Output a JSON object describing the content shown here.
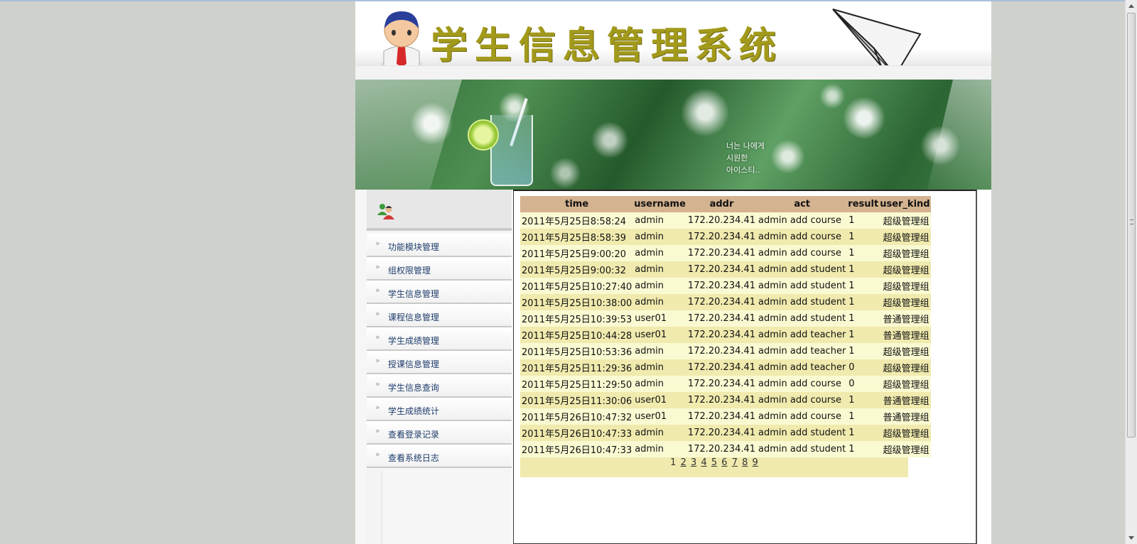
{
  "header": {
    "title": "学生信息管理系统"
  },
  "banner": {
    "overlay_text": "너는 나에게\n시원한\n아이스티.."
  },
  "sidebar": {
    "items": [
      {
        "label": "功能模块管理"
      },
      {
        "label": "组权限管理"
      },
      {
        "label": "学生信息管理"
      },
      {
        "label": "课程信息管理"
      },
      {
        "label": "学生成绩管理"
      },
      {
        "label": "授课信息管理"
      },
      {
        "label": "学生信息查询"
      },
      {
        "label": "学生成绩统计"
      },
      {
        "label": "查看登录记录"
      },
      {
        "label": "查看系统日志"
      }
    ]
  },
  "log_table": {
    "columns": [
      "time",
      "username",
      "addr",
      "act",
      "result",
      "user_kind"
    ],
    "rows": [
      [
        "2011年5月25日8:58:24",
        "admin",
        "172.20.234.41",
        "admin add course",
        "1",
        "超级管理组"
      ],
      [
        "2011年5月25日8:58:39",
        "admin",
        "172.20.234.41",
        "admin add course",
        "1",
        "超级管理组"
      ],
      [
        "2011年5月25日9:00:20",
        "admin",
        "172.20.234.41",
        "admin add course",
        "1",
        "超级管理组"
      ],
      [
        "2011年5月25日9:00:32",
        "admin",
        "172.20.234.41",
        "admin add student",
        "1",
        "超级管理组"
      ],
      [
        "2011年5月25日10:27:40",
        "admin",
        "172.20.234.41",
        "admin add student",
        "1",
        "超级管理组"
      ],
      [
        "2011年5月25日10:38:00",
        "admin",
        "172.20.234.41",
        "admin add student",
        "1",
        "超级管理组"
      ],
      [
        "2011年5月25日10:39:53",
        "user01",
        "172.20.234.41",
        "admin add student",
        "1",
        "普通管理组"
      ],
      [
        "2011年5月25日10:44:28",
        "user01",
        "172.20.234.41",
        "admin add teacher",
        "1",
        "普通管理组"
      ],
      [
        "2011年5月25日10:53:36",
        "admin",
        "172.20.234.41",
        "admin add teacher",
        "1",
        "超级管理组"
      ],
      [
        "2011年5月25日11:29:36",
        "admin",
        "172.20.234.41",
        "admin add teacher",
        "0",
        "超级管理组"
      ],
      [
        "2011年5月25日11:29:50",
        "admin",
        "172.20.234.41",
        "admin add course",
        "0",
        "超级管理组"
      ],
      [
        "2011年5月25日11:30:06",
        "user01",
        "172.20.234.41",
        "admin add course",
        "1",
        "普通管理组"
      ],
      [
        "2011年5月26日10:47:32",
        "user01",
        "172.20.234.41",
        "admin add course",
        "1",
        "普通管理组"
      ],
      [
        "2011年5月26日10:47:33",
        "admin",
        "172.20.234.41",
        "admin add student",
        "1",
        "超级管理组"
      ],
      [
        "2011年5月26日10:47:33",
        "admin",
        "172.20.234.41",
        "admin add student",
        "1",
        "超级管理组"
      ]
    ]
  },
  "pager": {
    "current": "1",
    "pages": [
      "2",
      "3",
      "4",
      "5",
      "6",
      "7",
      "8",
      "9"
    ]
  },
  "colors": {
    "header_bg": "#d4b390",
    "row_light": "#fafad2",
    "row_dark": "#f0eaae",
    "title_gold": "#a39a1b",
    "menu_text": "#1f3d6b"
  }
}
